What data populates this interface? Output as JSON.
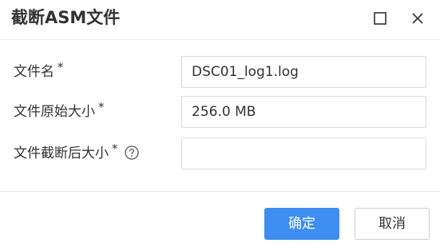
{
  "dialog": {
    "title": "截断ASM文件",
    "maximize_icon": "maximize-square-icon",
    "close_icon": "close-x-icon"
  },
  "form": {
    "fields": [
      {
        "label": "文件名",
        "required_mark": "*",
        "value": "DSC01_log1.log"
      },
      {
        "label": "文件原始大小",
        "required_mark": "*",
        "value": "256.0 MB"
      },
      {
        "label": "文件截断后大小",
        "required_mark": "*",
        "value": "",
        "help_icon": "question-circle-icon"
      }
    ]
  },
  "footer": {
    "confirm_label": "确定",
    "cancel_label": "取消",
    "primary_color": "#3d8ef0"
  }
}
